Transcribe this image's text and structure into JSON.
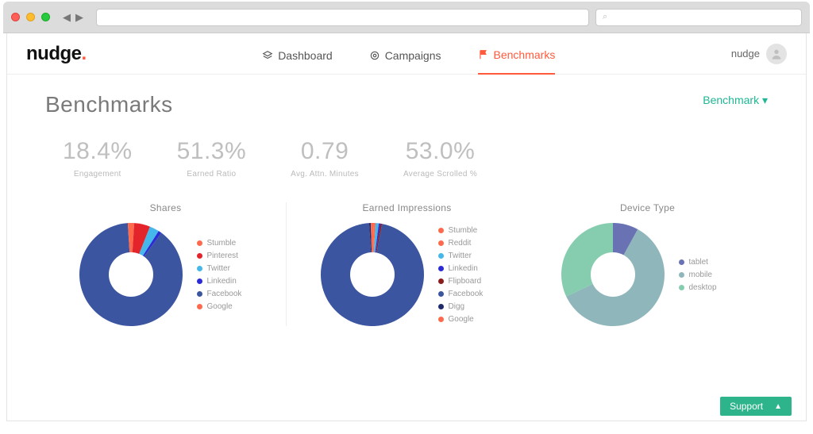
{
  "browser": {
    "search_placeholder": "⌕"
  },
  "header": {
    "logo": "nudge",
    "nav": [
      {
        "label": "Dashboard",
        "icon": "layers-icon"
      },
      {
        "label": "Campaigns",
        "icon": "target-icon"
      },
      {
        "label": "Benchmarks",
        "icon": "flag-icon"
      }
    ],
    "active_nav_index": 2,
    "user_label": "nudge"
  },
  "page": {
    "title": "Benchmarks",
    "dropdown_label": "Benchmark"
  },
  "metrics": [
    {
      "value": "18.4%",
      "label": "Engagement"
    },
    {
      "value": "51.3%",
      "label": "Earned Ratio"
    },
    {
      "value": "0.79",
      "label": "Avg. Attn. Minutes"
    },
    {
      "value": "53.0%",
      "label": "Average Scrolled %"
    }
  ],
  "charts": [
    {
      "title": "Shares",
      "legend": [
        {
          "name": "Stumble",
          "color": "#ff6a4d"
        },
        {
          "name": "Pinterest",
          "color": "#e3242b"
        },
        {
          "name": "Twitter",
          "color": "#46b7ea"
        },
        {
          "name": "Linkedin",
          "color": "#2b2bd6"
        },
        {
          "name": "Facebook",
          "color": "#3b55a0"
        },
        {
          "name": "Google",
          "color": "#ff6a4d"
        }
      ]
    },
    {
      "title": "Earned Impressions",
      "legend": [
        {
          "name": "Stumble",
          "color": "#ff6a4d"
        },
        {
          "name": "Reddit",
          "color": "#ff6a4d"
        },
        {
          "name": "Twitter",
          "color": "#46b7ea"
        },
        {
          "name": "Linkedin",
          "color": "#2b2bd6"
        },
        {
          "name": "Flipboard",
          "color": "#8a1c1c"
        },
        {
          "name": "Facebook",
          "color": "#3b55a0"
        },
        {
          "name": "Digg",
          "color": "#1f2a6b"
        },
        {
          "name": "Google",
          "color": "#ff6a4d"
        }
      ]
    },
    {
      "title": "Device Type",
      "legend": [
        {
          "name": "tablet",
          "color": "#6972b3"
        },
        {
          "name": "mobile",
          "color": "#8eb6bb"
        },
        {
          "name": "desktop",
          "color": "#86cdb0"
        }
      ]
    }
  ],
  "support_label": "Support",
  "colors": {
    "accent": "#ff5a3c",
    "success": "#1fb794"
  },
  "chart_data": [
    {
      "type": "pie",
      "title": "Shares",
      "series": [
        {
          "name": "Stumble",
          "value": 1,
          "color": "#ff6a4d"
        },
        {
          "name": "Pinterest",
          "value": 5,
          "color": "#e3242b"
        },
        {
          "name": "Twitter",
          "value": 3,
          "color": "#46b7ea"
        },
        {
          "name": "Linkedin",
          "value": 1,
          "color": "#2b2bd6"
        },
        {
          "name": "Facebook",
          "value": 89,
          "color": "#3b55a0"
        },
        {
          "name": "Google",
          "value": 1,
          "color": "#ff6a4d"
        }
      ]
    },
    {
      "type": "pie",
      "title": "Earned Impressions",
      "series": [
        {
          "name": "Stumble",
          "value": 0.5,
          "color": "#ff6a4d"
        },
        {
          "name": "Reddit",
          "value": 0.5,
          "color": "#ff6a4d"
        },
        {
          "name": "Twitter",
          "value": 1,
          "color": "#46b7ea"
        },
        {
          "name": "Linkedin",
          "value": 0.5,
          "color": "#2b2bd6"
        },
        {
          "name": "Flipboard",
          "value": 0.5,
          "color": "#8a1c1c"
        },
        {
          "name": "Facebook",
          "value": 96,
          "color": "#3b55a0"
        },
        {
          "name": "Digg",
          "value": 0.5,
          "color": "#1f2a6b"
        },
        {
          "name": "Google",
          "value": 0.5,
          "color": "#ff6a4d"
        }
      ]
    },
    {
      "type": "pie",
      "title": "Device Type",
      "series": [
        {
          "name": "tablet",
          "value": 8,
          "color": "#6972b3"
        },
        {
          "name": "mobile",
          "value": 60,
          "color": "#8eb6bb"
        },
        {
          "name": "desktop",
          "value": 32,
          "color": "#86cdb0"
        }
      ]
    }
  ]
}
